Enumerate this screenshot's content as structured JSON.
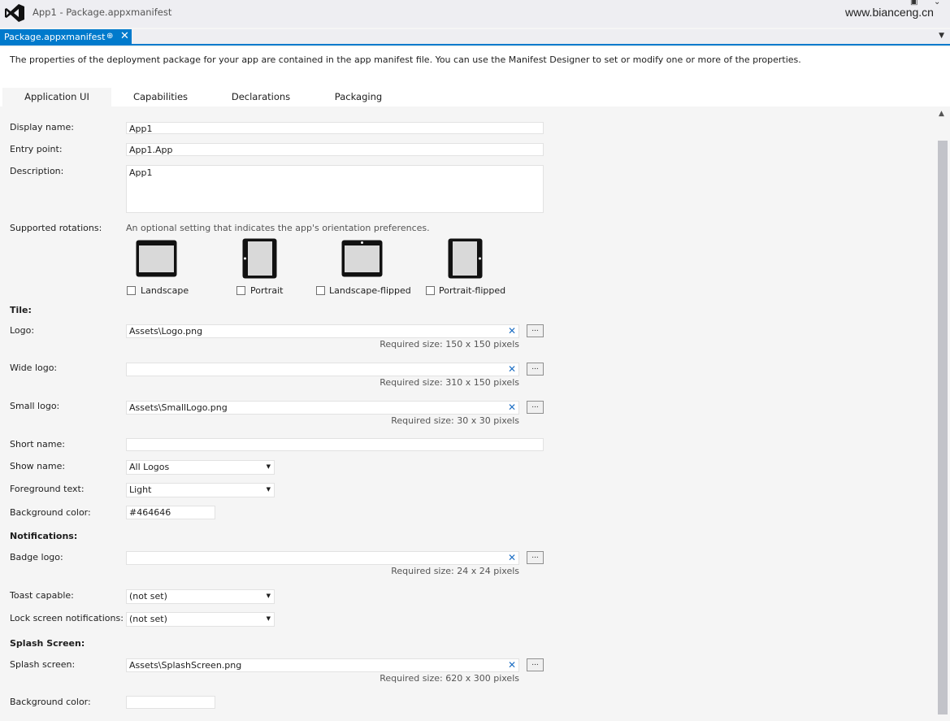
{
  "window": {
    "title": "App1 - Package.appxmanifest",
    "watermark": "www.bianceng.cn"
  },
  "doc_tab": {
    "label": "Package.appxmanifest",
    "pin_glyph": "⊕",
    "close_glyph": "✕"
  },
  "info": "The properties of the deployment package for your app are contained in the app manifest file. You can use the Manifest Designer to set or modify one or more of the properties.",
  "tabs": [
    "Application UI",
    "Capabilities",
    "Declarations",
    "Packaging"
  ],
  "active_tab": "Application UI",
  "form": {
    "display_name": {
      "label": "Display name:",
      "value": "App1"
    },
    "entry_point": {
      "label": "Entry point:",
      "value": "App1.App"
    },
    "description": {
      "label": "Description:",
      "value": "App1"
    },
    "rotations": {
      "label": "Supported rotations:",
      "hint": "An optional setting that indicates the app's orientation preferences.",
      "options": [
        "Landscape",
        "Portrait",
        "Landscape-flipped",
        "Portrait-flipped"
      ]
    },
    "tile": {
      "header": "Tile:",
      "logo": {
        "label": "Logo:",
        "value": "Assets\\Logo.png",
        "required": "Required size: 150 x 150 pixels"
      },
      "wide_logo": {
        "label": "Wide logo:",
        "value": "",
        "required": "Required size: 310 x 150 pixels"
      },
      "small_logo": {
        "label": "Small logo:",
        "value": "Assets\\SmallLogo.png",
        "required": "Required size: 30 x 30 pixels"
      },
      "short_name": {
        "label": "Short name:",
        "value": ""
      },
      "show_name": {
        "label": "Show name:",
        "value": "All Logos"
      },
      "foreground_text": {
        "label": "Foreground text:",
        "value": "Light"
      },
      "background_color": {
        "label": "Background color:",
        "value": "#464646"
      }
    },
    "notifications": {
      "header": "Notifications:",
      "badge_logo": {
        "label": "Badge logo:",
        "value": "",
        "required": "Required size: 24 x 24 pixels"
      },
      "toast_capable": {
        "label": "Toast capable:",
        "value": "(not set)"
      },
      "lock_screen": {
        "label": "Lock screen notifications:",
        "value": "(not set)"
      }
    },
    "splash": {
      "header": "Splash Screen:",
      "splash_screen": {
        "label": "Splash screen:",
        "value": "Assets\\SplashScreen.png",
        "required": "Required size: 620 x 300 pixels"
      },
      "background_color": {
        "label": "Background color:",
        "value": ""
      }
    }
  },
  "glyphs": {
    "clear": "✕",
    "browse": "...",
    "dropdown": "▼"
  },
  "colors": {
    "accent": "#007acc",
    "link_x": "#1e6fc4"
  }
}
